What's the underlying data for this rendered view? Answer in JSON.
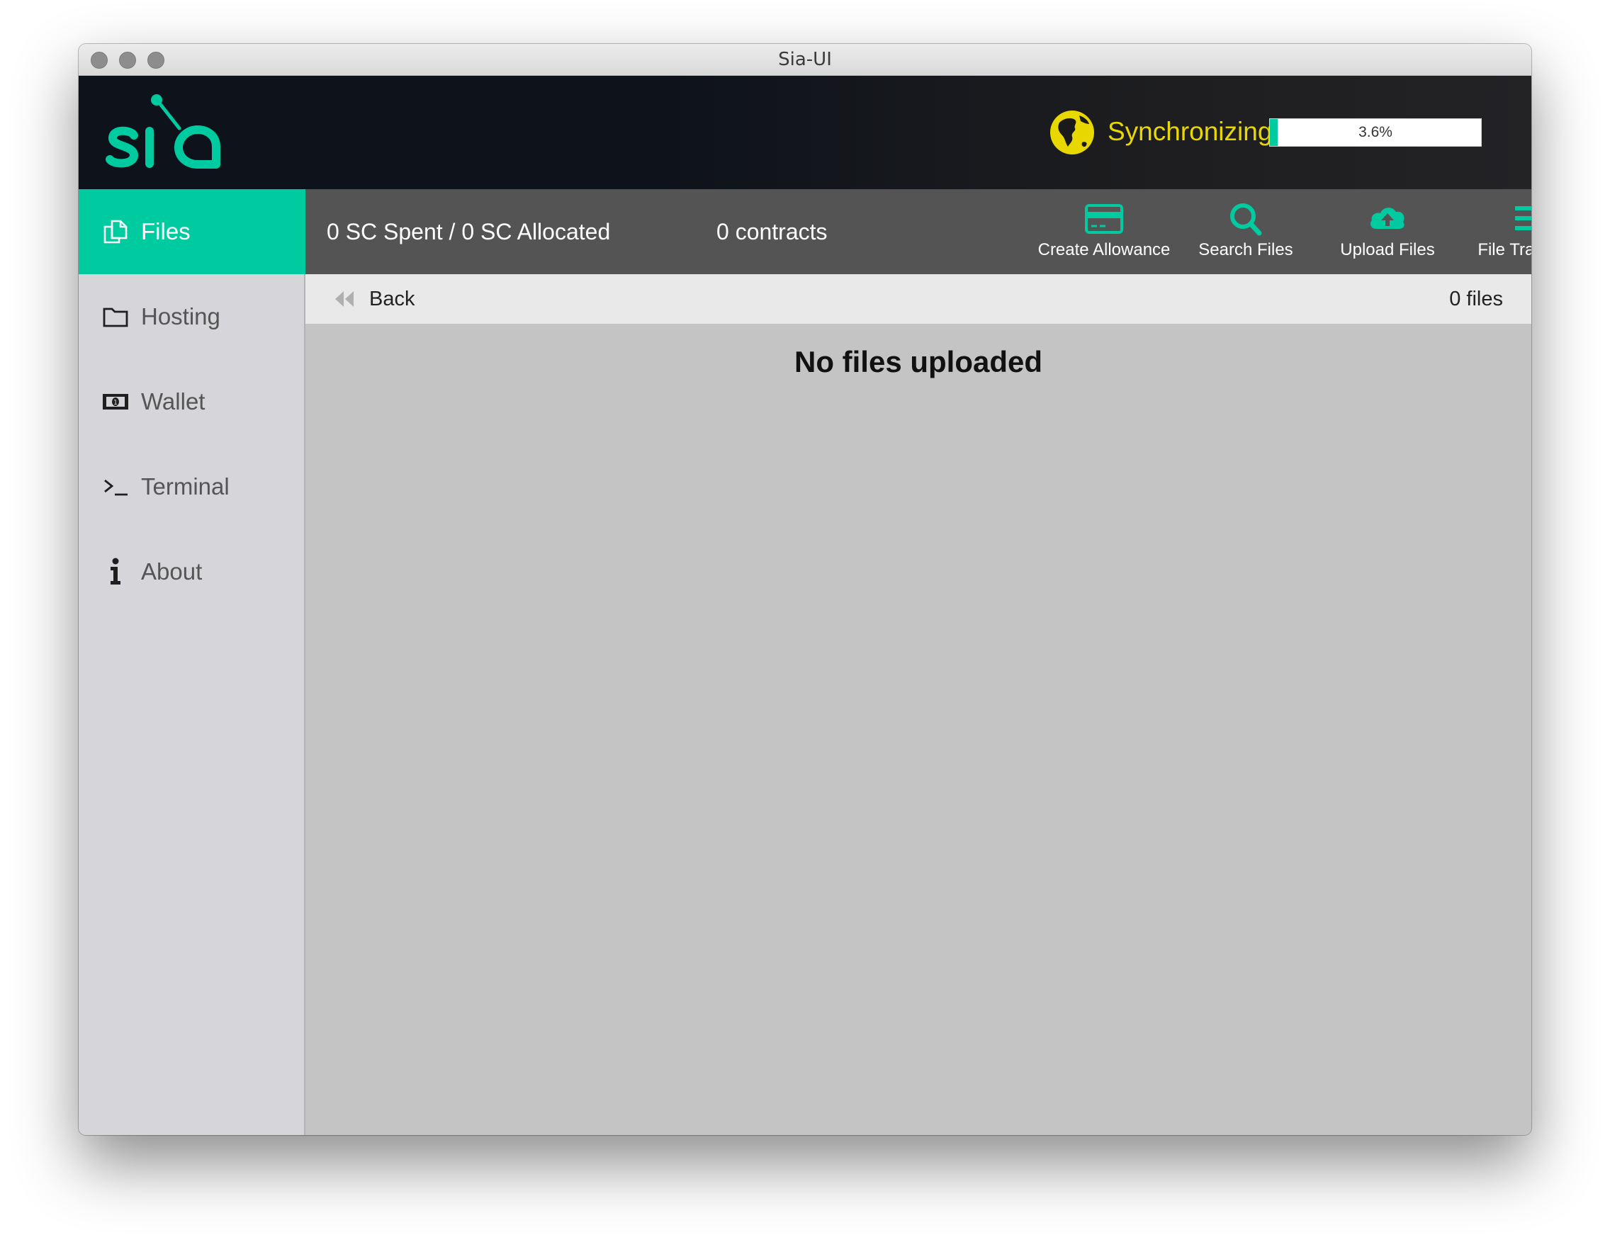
{
  "window": {
    "title": "Sia-UI"
  },
  "header": {
    "logo_icon": "sia-logo",
    "sync": {
      "label": "Synchronizing",
      "icon": "globe-icon",
      "progress": 3.6,
      "progress_label": "3.6%",
      "color": "#e8d800"
    }
  },
  "sidebar": {
    "items": [
      {
        "label": "Files",
        "icon": "files-icon",
        "active": true
      },
      {
        "label": "Hosting",
        "icon": "folder-icon",
        "active": false
      },
      {
        "label": "Wallet",
        "icon": "money-icon",
        "active": false
      },
      {
        "label": "Terminal",
        "icon": "terminal-icon",
        "active": false
      },
      {
        "label": "About",
        "icon": "info-icon",
        "active": false
      }
    ]
  },
  "toolbar": {
    "spent_allocated": "0 SC Spent / 0 SC Allocated",
    "contracts": "0 contracts",
    "tools": [
      {
        "label": "Create Allowance",
        "icon": "credit-card-icon"
      },
      {
        "label": "Search Files",
        "icon": "search-icon"
      },
      {
        "label": "Upload Files",
        "icon": "cloud-upload-icon"
      },
      {
        "label": "File Transfers",
        "icon": "list-icon"
      }
    ]
  },
  "breadcrumb": {
    "back_label": "Back",
    "file_count": "0 files"
  },
  "main": {
    "empty_message": "No files uploaded"
  },
  "colors": {
    "accent": "#00cba0",
    "toolbar": "#545454",
    "sidebar": "#d6d5d9"
  }
}
